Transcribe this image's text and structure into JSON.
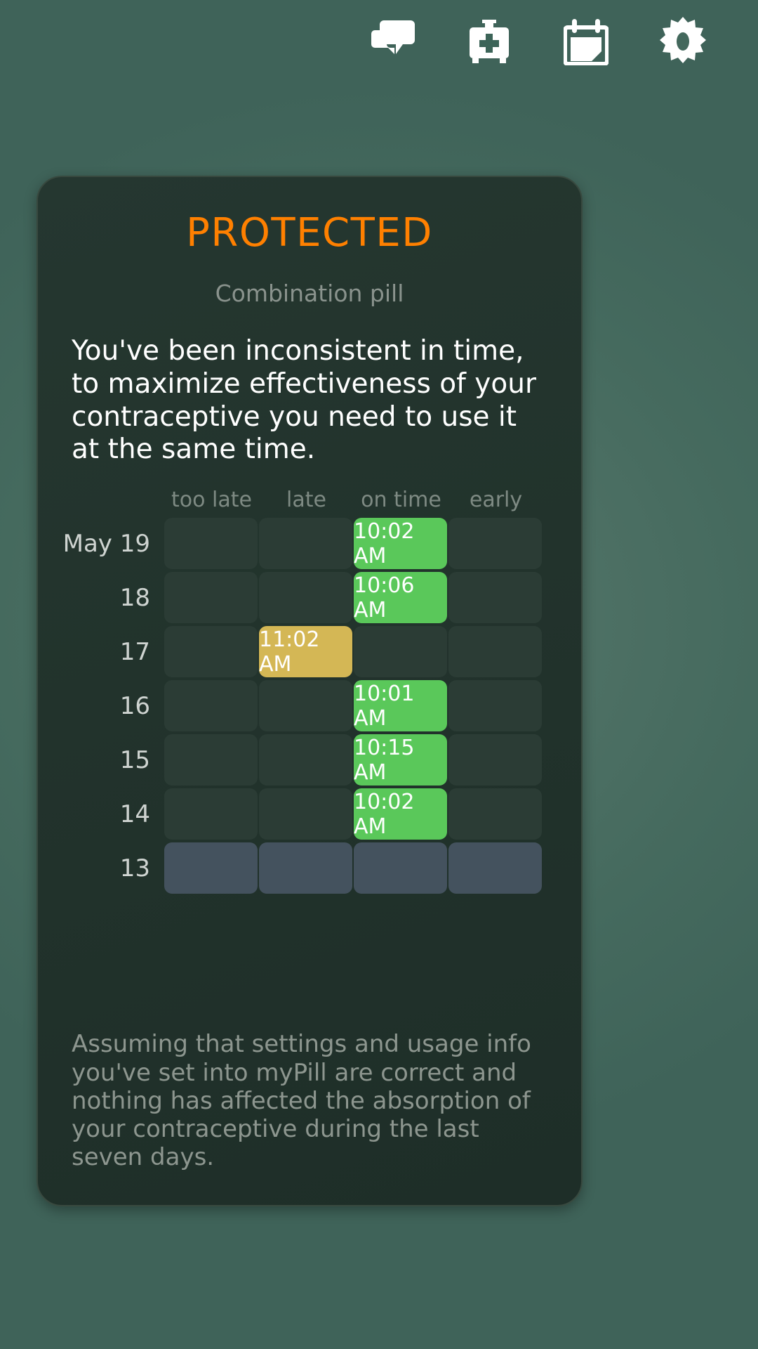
{
  "topbar": {
    "icons": [
      {
        "name": "chat-icon",
        "label": "Chat"
      },
      {
        "name": "medical-kit-icon",
        "label": "Medical kit"
      },
      {
        "name": "calendar-icon",
        "label": "Calendar"
      },
      {
        "name": "gear-icon",
        "label": "Settings"
      }
    ]
  },
  "card": {
    "status_title": "PROTECTED",
    "status_subtitle": "Combination pill",
    "message": "You've been inconsistent in time, to maximize effectiveness of your contraceptive you need to use it at the same time.",
    "footer_note": "Assuming that settings and usage info you've set into myPill are correct and nothing has affected the absorption of your contraceptive during the last seven days."
  },
  "schedule": {
    "columns": [
      "too late",
      "late",
      "on time",
      "early"
    ],
    "rows": [
      {
        "date": "May 19",
        "cells": [
          {
            "state": "empty",
            "time": ""
          },
          {
            "state": "empty",
            "time": ""
          },
          {
            "state": "ontime",
            "time": "10:02 AM"
          },
          {
            "state": "empty",
            "time": ""
          }
        ]
      },
      {
        "date": "18",
        "cells": [
          {
            "state": "empty",
            "time": ""
          },
          {
            "state": "empty",
            "time": ""
          },
          {
            "state": "ontime",
            "time": "10:06 AM"
          },
          {
            "state": "empty",
            "time": ""
          }
        ]
      },
      {
        "date": "17",
        "cells": [
          {
            "state": "empty",
            "time": ""
          },
          {
            "state": "late",
            "time": "11:02 AM"
          },
          {
            "state": "empty",
            "time": ""
          },
          {
            "state": "empty",
            "time": ""
          }
        ]
      },
      {
        "date": "16",
        "cells": [
          {
            "state": "empty",
            "time": ""
          },
          {
            "state": "empty",
            "time": ""
          },
          {
            "state": "ontime",
            "time": "10:01 AM"
          },
          {
            "state": "empty",
            "time": ""
          }
        ]
      },
      {
        "date": "15",
        "cells": [
          {
            "state": "empty",
            "time": ""
          },
          {
            "state": "empty",
            "time": ""
          },
          {
            "state": "ontime",
            "time": "10:15 AM"
          },
          {
            "state": "empty",
            "time": ""
          }
        ]
      },
      {
        "date": "14",
        "cells": [
          {
            "state": "empty",
            "time": ""
          },
          {
            "state": "empty",
            "time": ""
          },
          {
            "state": "ontime",
            "time": "10:02 AM"
          },
          {
            "state": "empty",
            "time": ""
          }
        ]
      },
      {
        "date": "13",
        "cells": [
          {
            "state": "pending",
            "time": ""
          },
          {
            "state": "pending",
            "time": ""
          },
          {
            "state": "pending",
            "time": ""
          },
          {
            "state": "pending",
            "time": ""
          }
        ]
      }
    ]
  },
  "colors": {
    "accent_orange": "#ff8000",
    "on_time_green": "#5ac85a",
    "late_yellow": "#d4b755",
    "pending_slate": "#44525e",
    "background_green": "#44685c",
    "card_dark": "#22332c"
  }
}
